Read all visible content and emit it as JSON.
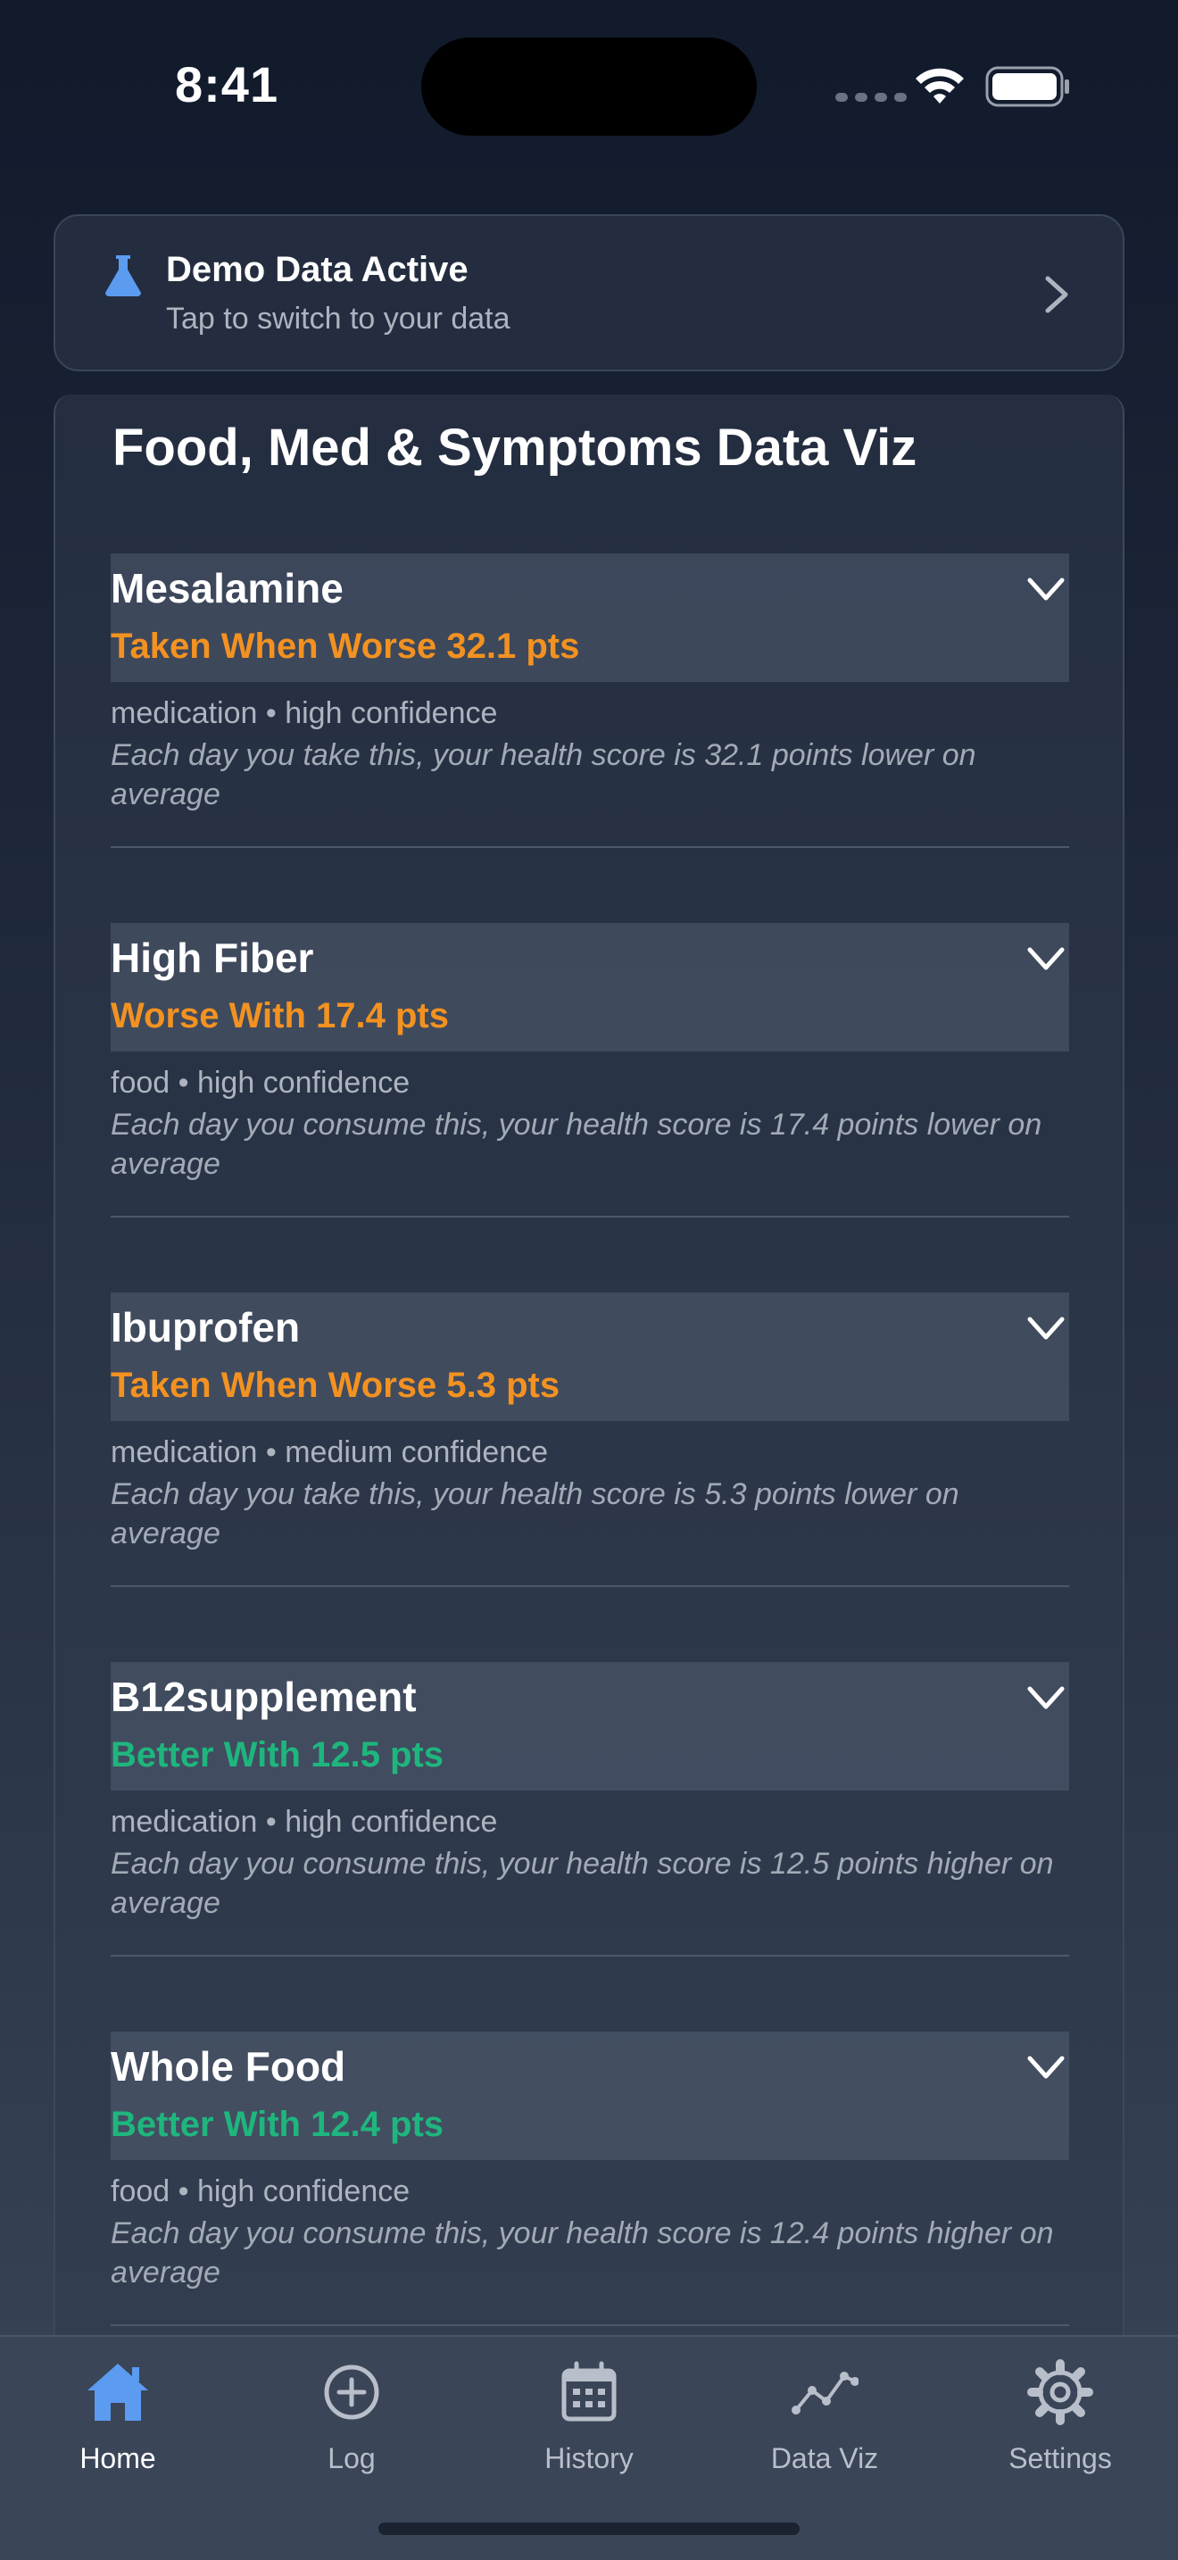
{
  "status_bar": {
    "time": "8:41"
  },
  "banner": {
    "icon": "flask-icon",
    "title": "Demo Data Active",
    "subtitle": "Tap to switch to your data"
  },
  "page": {
    "title": "Food, Med & Symptoms Data Viz"
  },
  "items": [
    {
      "name": "Mesalamine",
      "effect": "Taken When Worse 32.1 pts",
      "effect_type": "worse",
      "meta": "medication • high confidence",
      "description": "Each day you take this, your health score is 32.1 points lower on average"
    },
    {
      "name": "High Fiber",
      "effect": "Worse With 17.4 pts",
      "effect_type": "worse",
      "meta": "food • high confidence",
      "description": "Each day you consume this, your health score is 17.4 points lower on average"
    },
    {
      "name": "Ibuprofen",
      "effect": "Taken When Worse 5.3 pts",
      "effect_type": "worse",
      "meta": "medication • medium confidence",
      "description": "Each day you take this, your health score is 5.3 points lower on average"
    },
    {
      "name": "B12supplement",
      "effect": "Better With 12.5 pts",
      "effect_type": "better",
      "meta": "medication • high confidence",
      "description": "Each day you consume this, your health score is 12.5 points higher on average"
    },
    {
      "name": "Whole Food",
      "effect": "Better With 12.4 pts",
      "effect_type": "better",
      "meta": "food • high confidence",
      "description": "Each day you consume this, your health score is 12.4 points higher on average"
    }
  ],
  "colors": {
    "worse": "#f39221",
    "better": "#1fb67e",
    "accent": "#5b9bf0"
  },
  "tabs": [
    {
      "label": "Home",
      "icon": "home-icon",
      "active": true
    },
    {
      "label": "Log",
      "icon": "plus-circle-icon",
      "active": false
    },
    {
      "label": "History",
      "icon": "calendar-icon",
      "active": false
    },
    {
      "label": "Data Viz",
      "icon": "line-chart-icon",
      "active": false
    },
    {
      "label": "Settings",
      "icon": "gear-icon",
      "active": false
    }
  ]
}
